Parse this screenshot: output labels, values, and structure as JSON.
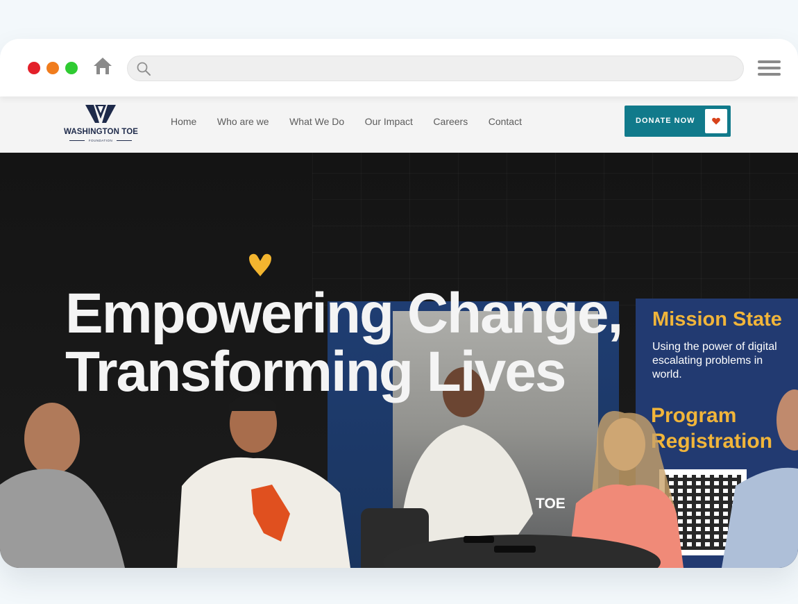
{
  "browser": {
    "address_text": ""
  },
  "site": {
    "logo": {
      "name": "WASHINGTON TOE",
      "subtitle": "FOUNDATION"
    },
    "nav": [
      {
        "label": "Home"
      },
      {
        "label": "Who are we"
      },
      {
        "label": "What We Do"
      },
      {
        "label": "Our Impact"
      },
      {
        "label": "Careers"
      },
      {
        "label": "Contact"
      }
    ],
    "donate_label": "DONATE NOW"
  },
  "hero": {
    "title": "Empowering Change,\nTransforming Lives",
    "banner_text": "TOE",
    "panel": {
      "title": "Mission State",
      "body": "Using the power of digital\nescalating  problems  in\nworld.",
      "program": "Program\nRegistration"
    }
  },
  "colors": {
    "brand_navy": "#1e2a4a",
    "donate_teal": "#117a8b",
    "accent_gold": "#f1b53a",
    "heart_red": "#d8431b"
  }
}
